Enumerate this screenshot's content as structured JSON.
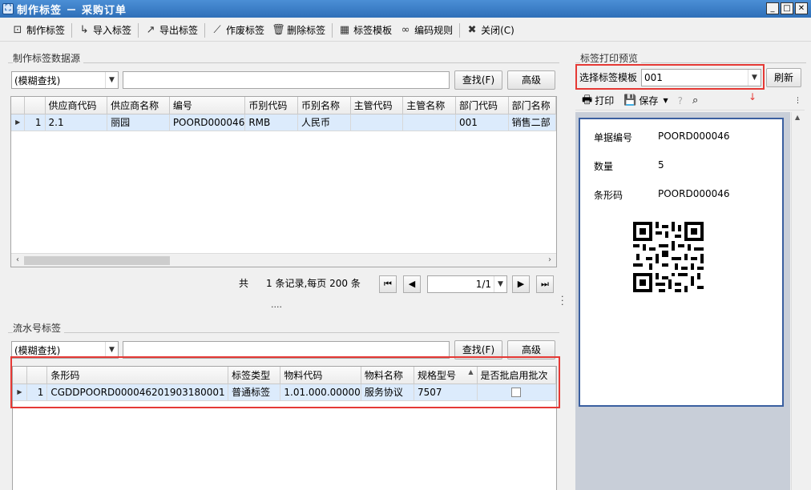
{
  "window": {
    "title": "制作标签 － 采购订单",
    "app_icon": "app-icon",
    "minimize": "_",
    "maximize": "□",
    "close": "✕"
  },
  "toolbar": [
    {
      "label": "制作标签",
      "icon": "make-label-icon",
      "glyph": "⊡"
    },
    {
      "label": "导入标签",
      "icon": "import-icon",
      "glyph": "↳"
    },
    {
      "label": "导出标签",
      "icon": "export-icon",
      "glyph": "↗"
    },
    {
      "label": "作废标签",
      "icon": "void-icon",
      "glyph": "⟋"
    },
    {
      "label": "删除标签",
      "icon": "trash-icon",
      "glyph": "🗑"
    },
    {
      "label": "标签模板",
      "icon": "template-icon",
      "glyph": "▦"
    },
    {
      "label": "编码规则",
      "icon": "link-icon",
      "glyph": "∞"
    },
    {
      "label": "关闭(C)",
      "icon": "close-icon",
      "glyph": "✖"
    }
  ],
  "source": {
    "group_title": "制作标签数据源",
    "search_mode": "(模糊查找)",
    "search_value": "",
    "find_button": "查找(F)",
    "advanced_button": "高级",
    "columns": [
      "供应商代码",
      "供应商名称",
      "编号",
      "币别代码",
      "币别名称",
      "主管代码",
      "主管名称",
      "部门代码",
      "部门名称"
    ],
    "rows": [
      {
        "index": "1",
        "cells": [
          "2.1",
          "丽园",
          "POORD000046",
          "RMB",
          "人民币",
          "",
          "",
          "001",
          "销售二部"
        ]
      }
    ],
    "pager": {
      "total_prefix": "共",
      "summary": "1 条记录,每页 200 条",
      "page": "1/1"
    }
  },
  "splitter": "....",
  "serial": {
    "group_title": "流水号标签",
    "search_mode": "(模糊查找)",
    "search_value": "",
    "find_button": "查找(F)",
    "advanced_button": "高级",
    "columns": [
      "条形码",
      "标签类型",
      "物料代码",
      "物料名称",
      "规格型号",
      "是否批启用批次"
    ],
    "rows": [
      {
        "index": "1",
        "cells": [
          "CGDDPOORD000046201903180001",
          "普通标签",
          "1.01.000.00000",
          "服务协议",
          "7507",
          ""
        ]
      }
    ]
  },
  "preview": {
    "group_title": "标签打印预览",
    "template_label": "选择标签模板",
    "template_value": "001",
    "refresh_button": "刷新",
    "print_button": "打印",
    "save_button": "保存",
    "fields": [
      {
        "label": "单据编号",
        "value": "POORD000046"
      },
      {
        "label": "数量",
        "value": "5"
      },
      {
        "label": "条形码",
        "value": "POORD000046"
      }
    ]
  },
  "colors": {
    "highlight_border": "#e53935",
    "selected_row": "#dcebfc",
    "title_bar": "#2f6fb8"
  }
}
